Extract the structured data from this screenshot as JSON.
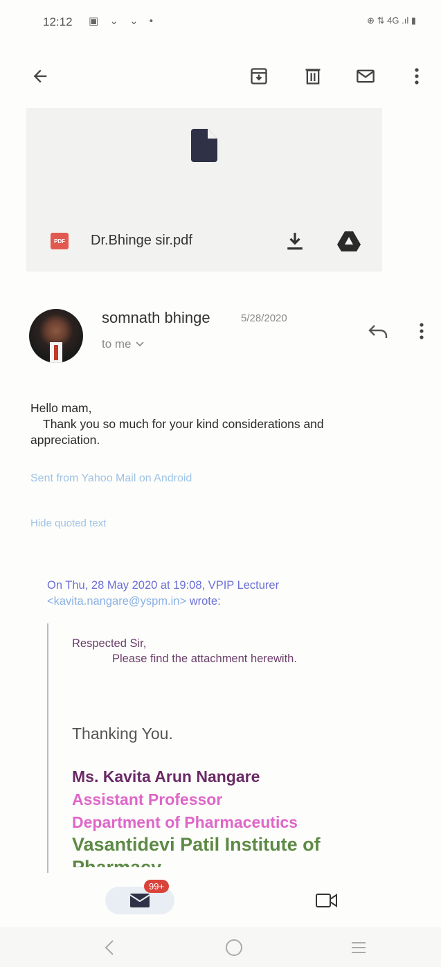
{
  "status_bar": {
    "time": "12:12",
    "notifications": "▣ ⌄ ⌄ •",
    "system": "⊕ ⇅ 4G .ıl ▮"
  },
  "toolbar": {
    "back_icon": "arrow-left-icon",
    "archive_icon": "archive-icon",
    "delete_icon": "trash-icon",
    "mark_unread_icon": "mail-icon",
    "more_icon": "more-vert-icon"
  },
  "attachment": {
    "badge": "PDF",
    "name": "Dr.Bhinge sir.pdf",
    "badge_color": "#e2594f"
  },
  "message": {
    "sender": "somnath bhinge",
    "date": "5/28/2020",
    "to": "to me",
    "greeting": "Hello mam,",
    "line1": "Thank you so much for your kind considerations and",
    "line2": "appreciation.",
    "signature_link": "Sent from Yahoo Mail on Android",
    "hide_quoted": "Hide quoted text"
  },
  "quoted": {
    "header_prefix": "On Thu, 28 May 2020 at 19:08, VPIP Lecturer",
    "email": "<kavita.nangare@yspm.in>",
    "header_suffix": "wrote:",
    "salutation": "Respected Sir,",
    "body": "Please find the attachment herewith.",
    "thanks": "Thanking You.",
    "name": "Ms. Kavita  Arun Nangare",
    "title": "Assistant Professor",
    "department": "Department of Pharmaceutics",
    "institute_line1": "Vasantidevi Patil Institute of",
    "institute_line2": "Pharmacy"
  },
  "bottom_nav": {
    "mail_badge": "99+"
  }
}
